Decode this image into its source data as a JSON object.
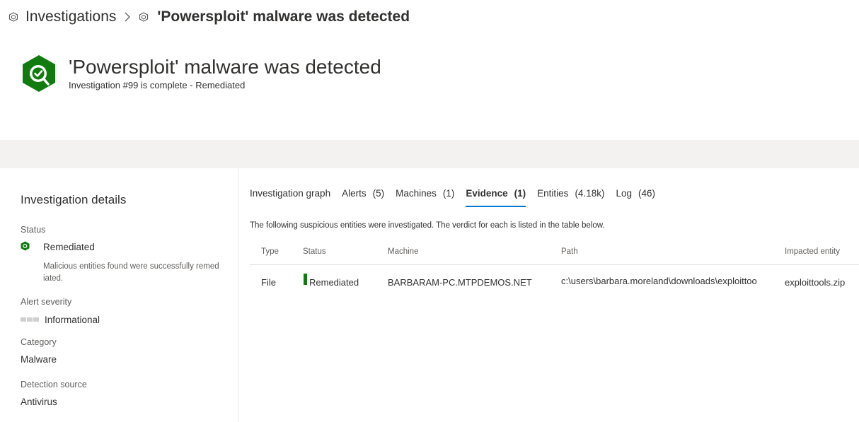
{
  "breadcrumb": {
    "parent": "Investigations",
    "current": "'Powersploit' malware was detected"
  },
  "header": {
    "title": "'Powersploit' malware was detected",
    "subtitle": "Investigation #99 is complete - Remediated",
    "icon": "shield-check-icon",
    "icon_color": "#107c10"
  },
  "details": {
    "title": "Investigation details",
    "status_label": "Status",
    "status_value": "Remediated",
    "status_description": "Malicious entities found were successfully remediated.",
    "severity_label": "Alert severity",
    "severity_value": "Informational",
    "category_label": "Category",
    "category_value": "Malware",
    "source_label": "Detection source",
    "source_value": "Antivirus"
  },
  "tabs": [
    {
      "label": "Investigation graph",
      "count": ""
    },
    {
      "label": "Alerts",
      "count": "(5)"
    },
    {
      "label": "Machines",
      "count": "(1)"
    },
    {
      "label": "Evidence",
      "count": "(1)"
    },
    {
      "label": "Entities",
      "count": "(4.18k)"
    },
    {
      "label": "Log",
      "count": "(46)"
    }
  ],
  "intro": "The following suspicious entities were investigated. The verdict for each is listed in the table below.",
  "table": {
    "columns": [
      "Type",
      "Status",
      "Machine",
      "Path",
      "Impacted entity"
    ],
    "rows": [
      {
        "type": "File",
        "status": "Remediated",
        "machine": "BARBARAM-PC.MTPDEMOS.NET",
        "path": "c:\\users\\barbara.moreland\\downloads\\exploittoo",
        "entity": "exploittools.zip"
      }
    ]
  },
  "colors": {
    "accent": "#0078d4",
    "remediated": "#107c10",
    "band": "#f3f2f1"
  }
}
